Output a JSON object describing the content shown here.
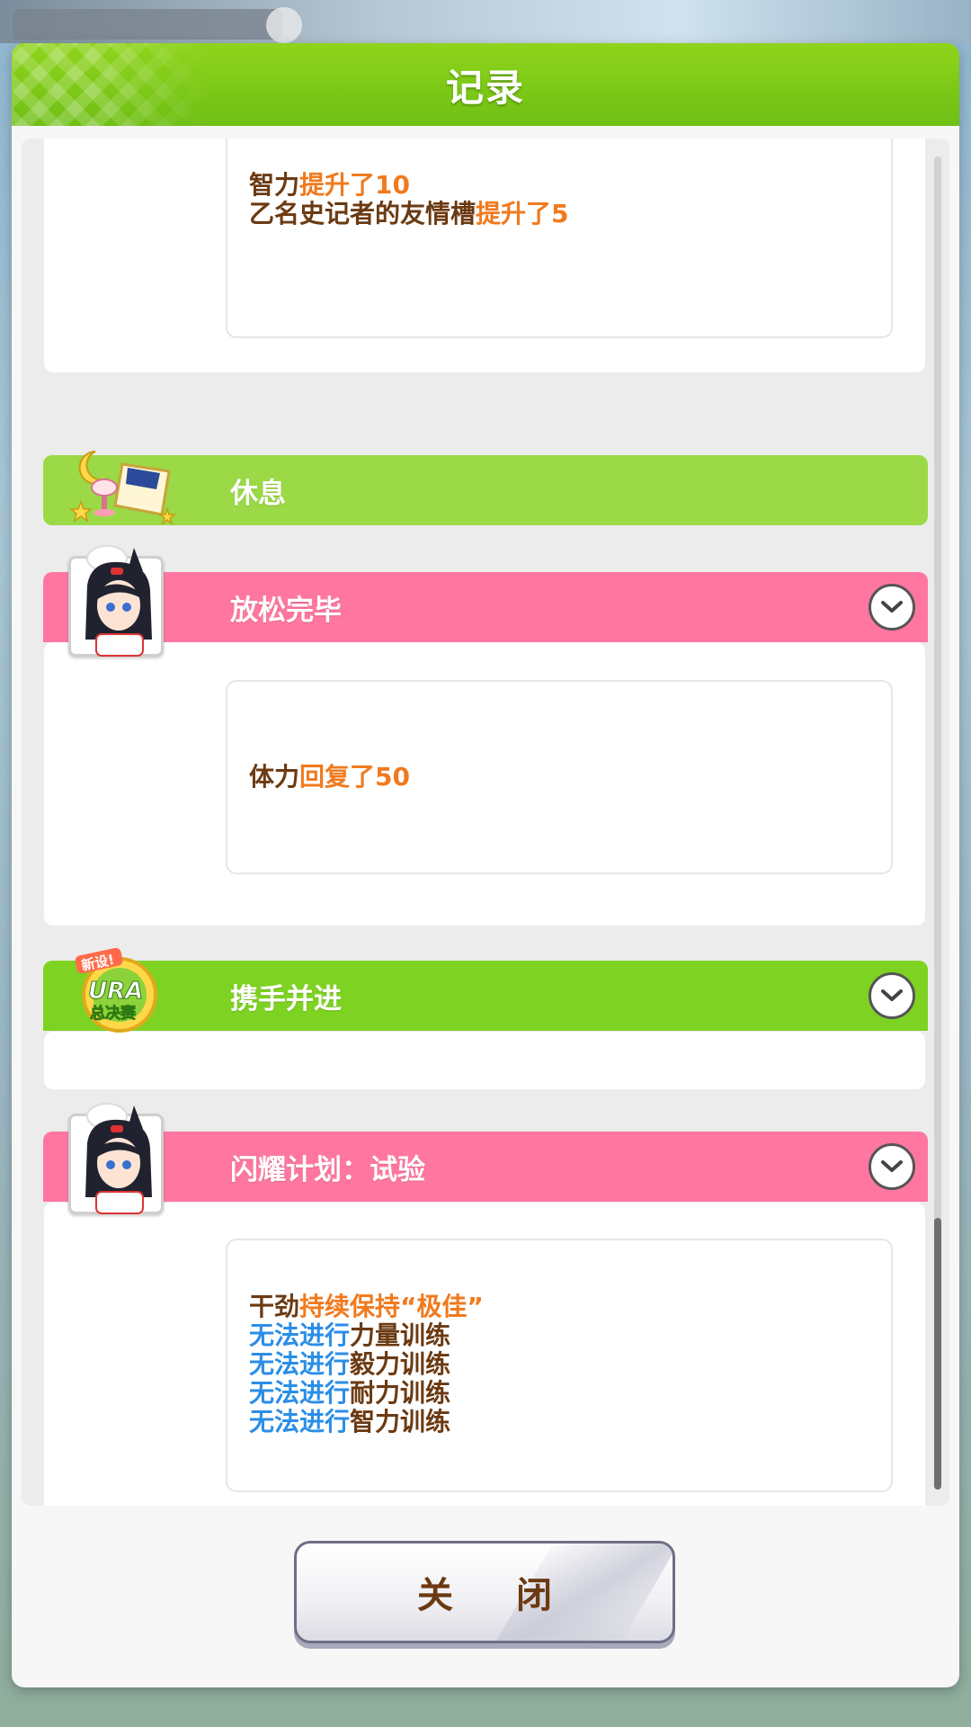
{
  "dialog": {
    "title": "记录",
    "close_label": "关 闭"
  },
  "entries": {
    "top_card": {
      "line1": {
        "prefix": "智力",
        "highlight": "提升了10"
      },
      "line2": {
        "prefix": "乙名史记者的友情槽",
        "highlight": "提升了5"
      }
    },
    "rest": {
      "label": "休息"
    },
    "relax": {
      "label": "放松完毕",
      "line1": {
        "prefix": "体力",
        "highlight": "回复了50"
      }
    },
    "together": {
      "label": "携手并进",
      "icon_text": {
        "top": "新设!",
        "mid": "URA",
        "bottom": "总决赛"
      }
    },
    "shine": {
      "label": "闪耀计划：试验",
      "lines": [
        {
          "prefix": "干劲",
          "highlight": "持续保持“极佳”"
        },
        {
          "blue": "无法进行",
          "rest": "力量训练"
        },
        {
          "blue": "无法进行",
          "rest": "毅力训练"
        },
        {
          "blue": "无法进行",
          "rest": "耐力训练"
        },
        {
          "blue": "无法进行",
          "rest": "智力训练"
        }
      ]
    }
  },
  "colors": {
    "header_green": "#7ed222",
    "rest_green": "#9bd947",
    "pink_bar": "#ff77a0",
    "text_brown": "#6b3a12",
    "text_orange": "#f07a1e",
    "text_blue": "#2b8ee6"
  },
  "icons": {
    "chevron": "chevron-down-icon",
    "rest": "moon-lamp-pillow-icon",
    "ura": "ura-finals-badge-icon",
    "portrait": "character-portrait"
  }
}
